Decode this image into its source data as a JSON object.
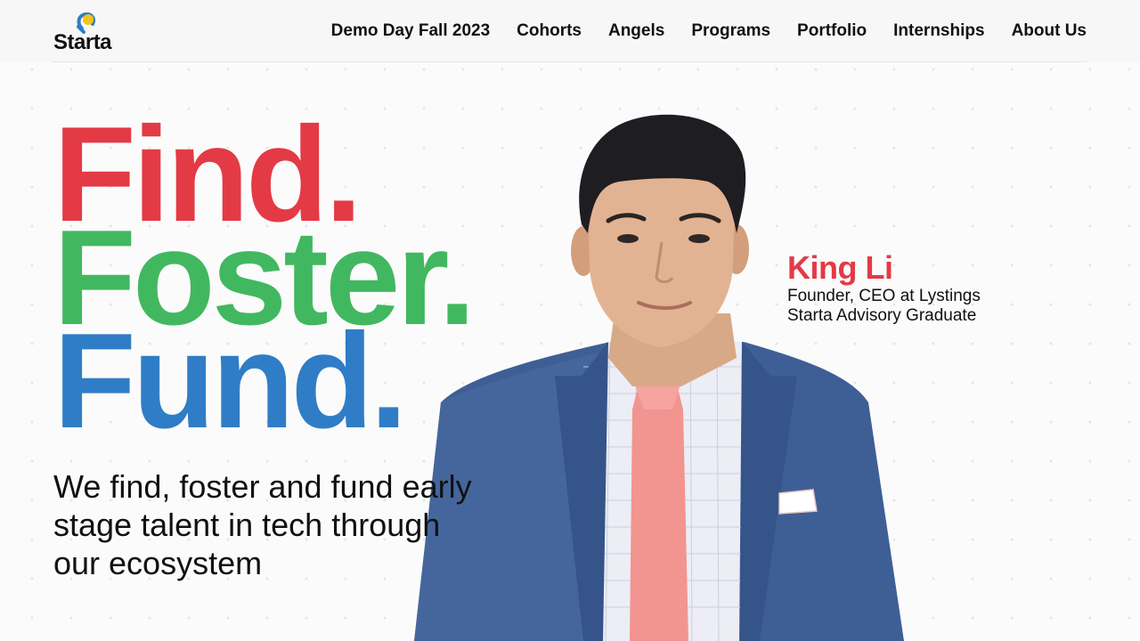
{
  "brand": {
    "name": "Starta",
    "colors": {
      "red": "#e33a46",
      "green": "#41b860",
      "blue": "#2f7dc6",
      "yellow": "#f3c318"
    }
  },
  "nav": {
    "items": [
      {
        "label": "Demo Day Fall 2023"
      },
      {
        "label": "Cohorts"
      },
      {
        "label": "Angels"
      },
      {
        "label": "Programs"
      },
      {
        "label": "Portfolio"
      },
      {
        "label": "Internships"
      },
      {
        "label": "About Us"
      }
    ]
  },
  "hero": {
    "headline": [
      "Find.",
      "Foster.",
      "Fund."
    ],
    "subheading": "We find, foster and fund early stage talent in tech through our ecosystem"
  },
  "testimonial": {
    "name": "King Li",
    "role": "Founder, CEO at Lystings",
    "note": "Starta Advisory Graduate"
  }
}
